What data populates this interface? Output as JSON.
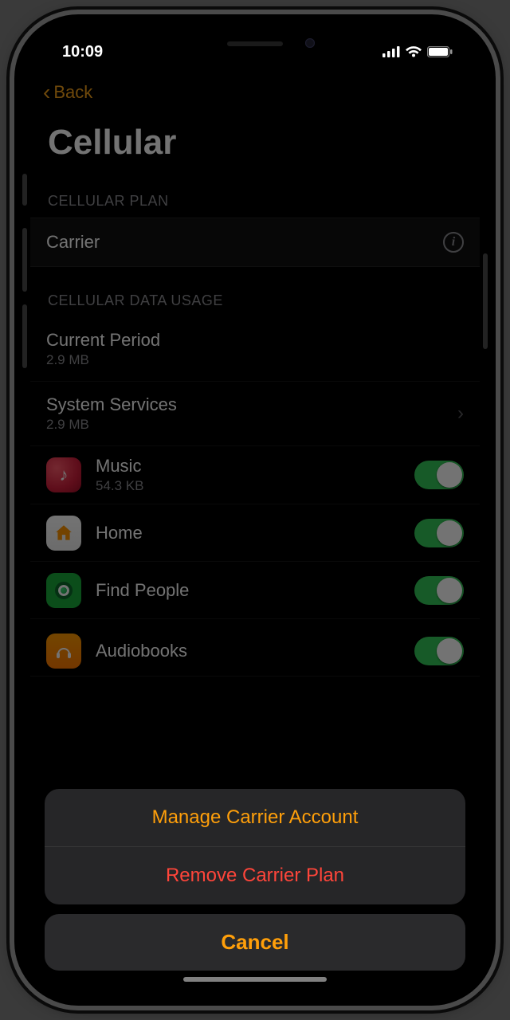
{
  "status": {
    "time": "10:09"
  },
  "nav": {
    "back_label": "Back"
  },
  "page_title": "Cellular",
  "sections": {
    "plan_header": "CELLULAR PLAN",
    "usage_header": "CELLULAR DATA USAGE"
  },
  "plan": {
    "carrier_label": "Carrier"
  },
  "usage": {
    "current_period": {
      "label": "Current Period",
      "value": "2.9 MB"
    },
    "system_services": {
      "label": "System Services",
      "value": "2.9 MB"
    }
  },
  "apps": [
    {
      "name": "Music",
      "detail": "54.3 KB",
      "icon": "music",
      "enabled": true
    },
    {
      "name": "Home",
      "detail": "",
      "icon": "home",
      "enabled": true
    },
    {
      "name": "Find People",
      "detail": "",
      "icon": "find",
      "enabled": true
    },
    {
      "name": "Audiobooks",
      "detail": "",
      "icon": "books",
      "enabled": true
    }
  ],
  "action_sheet": {
    "manage": "Manage Carrier Account",
    "remove": "Remove Carrier Plan",
    "cancel": "Cancel"
  }
}
